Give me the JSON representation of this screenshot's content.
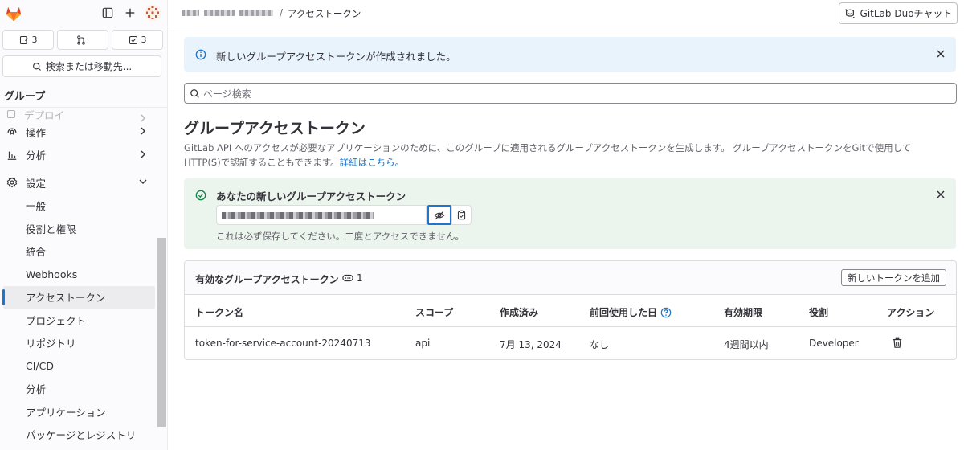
{
  "sidebar": {
    "counts": {
      "issues": "3",
      "merge_requests": "",
      "todos": "3"
    },
    "search_label": "検索または移動先...",
    "group_label": "グループ",
    "sections": [
      {
        "label": "デプロイ"
      },
      {
        "label": "操作"
      },
      {
        "label": "分析"
      },
      {
        "label": "設定"
      }
    ],
    "settings_items": [
      "一般",
      "役割と権限",
      "統合",
      "Webhooks",
      "アクセストークン",
      "プロジェクト",
      "リポジトリ",
      "CI/CD",
      "分析",
      "アプリケーション",
      "パッケージとレジストリ"
    ]
  },
  "topbar": {
    "breadcrumb_separator": "/",
    "breadcrumb_current": "アクセストークン",
    "duo_button": "GitLab Duoチャット"
  },
  "alert_info": {
    "message": "新しいグループアクセストークンが作成されました。"
  },
  "page_search": {
    "placeholder": "ページ検索"
  },
  "page": {
    "title": "グループアクセストークン",
    "description": "GitLab API へのアクセスが必要なアプリケーションのために、このグループに適用されるグループアクセストークンを生成します。 グループアクセストークンをGitで使用して HTTP(S)で認証することもできます。",
    "learn_more": "詳細はこちら。"
  },
  "alert_success": {
    "title": "あなたの新しいグループアクセストークン",
    "note": "これは必ず保存してください。二度とアクセスできません。"
  },
  "tokens_card": {
    "title": "有効なグループアクセストークン",
    "count": "1",
    "add_button": "新しいトークンを追加",
    "columns": [
      "トークン名",
      "スコープ",
      "作成済み",
      "前回使用した日",
      "有効期限",
      "役割",
      "アクション"
    ],
    "rows": [
      {
        "name": "token-for-service-account-20240713",
        "scope": "api",
        "created": "7月 13, 2024",
        "last_used": "なし",
        "expires": "4週間以内",
        "role": "Developer"
      }
    ]
  },
  "colors": {
    "accent": "#1f75cb",
    "success": "#108548",
    "info_bg": "#e9f3fc",
    "success_bg": "#ecf4ee",
    "logo": "#e24329"
  }
}
